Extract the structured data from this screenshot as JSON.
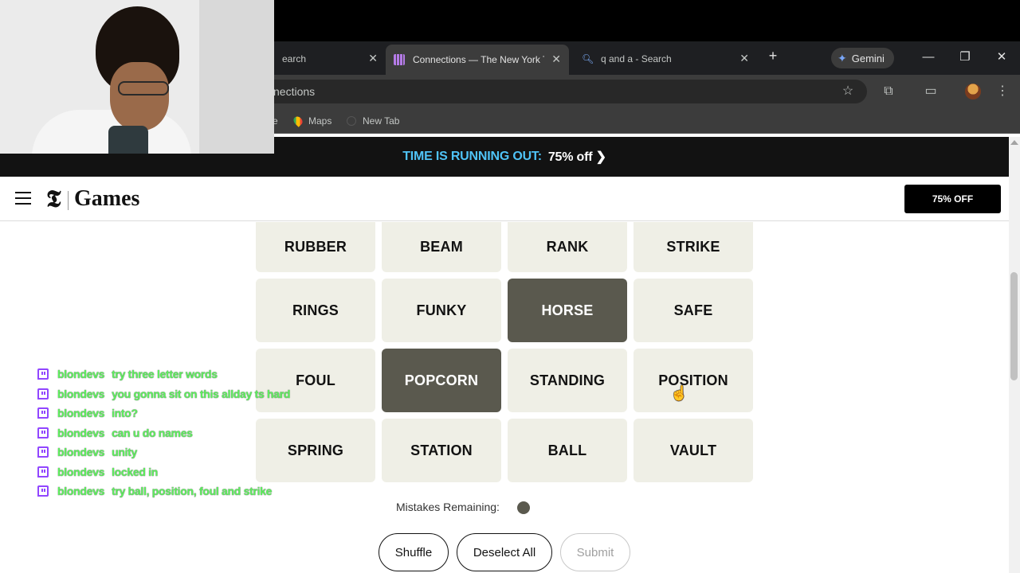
{
  "browser": {
    "tabs": [
      {
        "title": "earch",
        "active": false
      },
      {
        "title": "Connections — The New York Times",
        "active": true
      },
      {
        "title": "q and a - Search",
        "active": false
      }
    ],
    "new_tab_symbol": "+",
    "gemini_label": "Gemini",
    "address_text": "nections",
    "bookmarks": [
      {
        "label": "e"
      },
      {
        "label": "Maps"
      },
      {
        "label": "New Tab"
      }
    ]
  },
  "promo": {
    "headline": "TIME IS RUNNING OUT:",
    "offer": "75% off ❯"
  },
  "header": {
    "logo_mark": "𝕿",
    "logo_text": "Games",
    "subscribe_label": "75% OFF"
  },
  "board": {
    "tiles": [
      {
        "word": "RUBBER",
        "selected": false
      },
      {
        "word": "BEAM",
        "selected": false
      },
      {
        "word": "RANK",
        "selected": false
      },
      {
        "word": "STRIKE",
        "selected": false
      },
      {
        "word": "RINGS",
        "selected": false
      },
      {
        "word": "FUNKY",
        "selected": false
      },
      {
        "word": "HORSE",
        "selected": true
      },
      {
        "word": "SAFE",
        "selected": false
      },
      {
        "word": "FOUL",
        "selected": false
      },
      {
        "word": "POPCORN",
        "selected": true
      },
      {
        "word": "STANDING",
        "selected": false
      },
      {
        "word": "POSITION",
        "selected": false
      },
      {
        "word": "SPRING",
        "selected": false
      },
      {
        "word": "STATION",
        "selected": false
      },
      {
        "word": "BALL",
        "selected": false
      },
      {
        "word": "VAULT",
        "selected": false
      }
    ],
    "mistakes_label": "Mistakes Remaining:",
    "mistakes_remaining": 1,
    "buttons": {
      "shuffle": "Shuffle",
      "deselect": "Deselect All",
      "submit": "Submit"
    }
  },
  "chat": [
    {
      "user": "blondevs",
      "message": "try three letter words"
    },
    {
      "user": "blondevs",
      "message": "you gonna sit on this allday ts hard"
    },
    {
      "user": "blondevs",
      "message": "into?"
    },
    {
      "user": "blondevs",
      "message": "can u do names"
    },
    {
      "user": "blondevs",
      "message": "unity"
    },
    {
      "user": "blondevs",
      "message": "locked in"
    },
    {
      "user": "blondevs",
      "message": "try ball, position, foul and strike"
    }
  ],
  "colors": {
    "tile_bg": "#efefe6",
    "tile_selected": "#5a594e",
    "promo_accent": "#4fc3f7",
    "chat_text": "#5ef05e",
    "twitch_purple": "#9146ff"
  }
}
